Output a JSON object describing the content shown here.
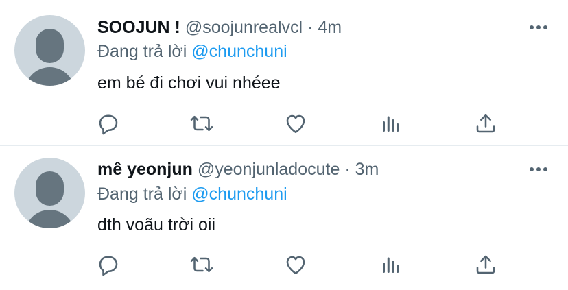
{
  "tweets": [
    {
      "name": "SOOJUN !",
      "handle": "@soojunrealvcl",
      "separator": "·",
      "time": "4m",
      "reply_prefix": "Đang trả lời",
      "reply_to": "@chunchuni",
      "text": "em bé đi chơi vui nhéee"
    },
    {
      "name": "mê yeonjun",
      "handle": "@yeonjunladocute",
      "separator": "·",
      "time": "3m",
      "reply_prefix": "Đang trả lời",
      "reply_to": "@chunchuni",
      "text": "dth voãu trời oii"
    }
  ],
  "icons": {
    "reply": "reply-icon",
    "retweet": "retweet-icon",
    "like": "heart-icon",
    "analytics": "analytics-icon",
    "share": "share-icon",
    "more": "more-icon"
  },
  "colors": {
    "icon_gray": "#536471",
    "mention_blue": "#1d9bf0",
    "avatar_bg": "#ccd6dd",
    "divider": "#e6ecf0"
  }
}
